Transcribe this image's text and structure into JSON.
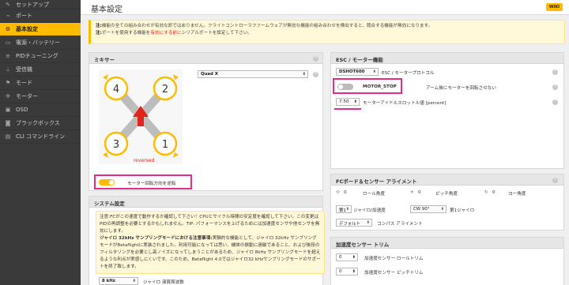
{
  "sidebar": {
    "items": [
      {
        "label": "セットアップ",
        "icon": "wrench-icon",
        "glyph": "✎"
      },
      {
        "label": "ポート",
        "icon": "plug-icon",
        "glyph": "⌁"
      },
      {
        "label": "基本設定",
        "icon": "gear-icon",
        "glyph": "⚙"
      },
      {
        "label": "電源・バッテリー",
        "icon": "battery-icon",
        "glyph": "▭"
      },
      {
        "label": "PIDチューニング",
        "icon": "sliders-icon",
        "glyph": "≡"
      },
      {
        "label": "受信機",
        "icon": "antenna-icon",
        "glyph": "⊥"
      },
      {
        "label": "モード",
        "icon": "flag-icon",
        "glyph": "⚑"
      },
      {
        "label": "モーター",
        "icon": "motor-icon",
        "glyph": "✣"
      },
      {
        "label": "OSD",
        "icon": "display-icon",
        "glyph": "▣"
      },
      {
        "label": "ブラックボックス",
        "icon": "blackbox-icon",
        "glyph": "◙"
      },
      {
        "label": "CLI コマンドライン",
        "icon": "terminal-icon",
        "glyph": "▤"
      }
    ],
    "active_index": 2
  },
  "header": {
    "title": "基本設定",
    "wiki_label": "WIKI"
  },
  "note": {
    "line1_bold": "注:",
    "line1": "機能の全ての組み合わせが有効な訳ではありません。フライトコントローラファームウェアが無効な機能の組み合わせを検出すると、競合する機能が無効になります。",
    "line2_bold": "注:",
    "line2_pre": "ポートを使用する機能を",
    "line2_red": "有効にする前に",
    "line2_post": "シリアルポートを設定して下さい。"
  },
  "mixer": {
    "title": "ミキサー",
    "type_value": "Quad X",
    "motors": [
      "4",
      "2",
      "3",
      "1"
    ],
    "reversed_label": "reversed",
    "reverse_toggle_label": "モーター回転方向を逆転",
    "reverse_toggle_on": true
  },
  "esc": {
    "title": "ESC / モーター機能",
    "protocol_value": "DSHOT600",
    "protocol_label": "ESC / モータープロトコル",
    "motor_stop_label": "MOTOR_STOP",
    "motor_stop_desc": "アーム後にモーターを回転させない",
    "motor_stop_on": false,
    "idle_value": "7.50",
    "idle_label": "モーターアイドルスロットル値 [percent]"
  },
  "board": {
    "title": "FCボード＆センサー アライメント",
    "roll_value": "0",
    "roll_label": "ロール角度",
    "pitch_value": "0",
    "pitch_label": "ピッチ角度",
    "yaw_value": "0",
    "yaw_label": "ヨー角度",
    "gyro_select": "第1",
    "gyro_label": "ジャイロ/加速度",
    "cw_value": "CW 90°",
    "first_gyro_label": "第1ジャイロ",
    "compass_value": "デフォルト",
    "compass_label": "コンパス アライメント"
  },
  "acc_trim": {
    "title": "加速度センサー トリム",
    "roll_value": "0",
    "roll_label": "加速度センサー ロールトリム",
    "pitch_value": "0",
    "pitch_label": "加速度センサー ピッチトリム"
  },
  "system": {
    "title": "システム設定",
    "line1": "注意:FCがこの速度で動作するか確認して下さい！CPUとサイクル時間の安定度を確認して下さい。この変更はPIDの再調整を必要とするかもしれません。TIP: パフォーマンスを上げるためには加速度センサや他センサを無効にします。",
    "line2_bold": "ジャイロ 32kHz サンプリングモードにおける注意事項:",
    "line2": "実験的な機能として、ジャイロ 32kHz サンプリングモードがBetaflightに実装されました。利用可能になっては思い、機体の振動に過敏であること、および後段のフィルタリングを必要とし高ノイズになってしまうことがあるため、ジャイロ 8kHz サンプリングモードを超えるような利点が実感しにくいです。このため、Betaflight 4.0ではジャイロ32 kHzサンプリングモードのサポートを終了致します。",
    "rate_value": "8 kHz",
    "rate_label": "ジャイロ 演算周波数"
  },
  "colors": {
    "accent": "#ffbb00",
    "highlight": "#e22b8a",
    "arrow": "#e2231a",
    "sidebar_bg": "#3a3a3a"
  }
}
